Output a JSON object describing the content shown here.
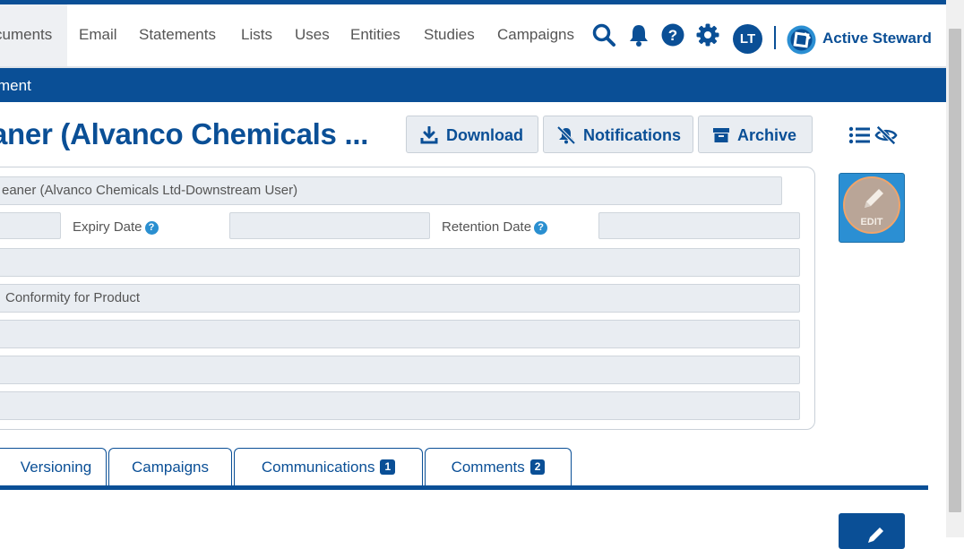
{
  "nav": {
    "items": [
      {
        "label": "cuments",
        "active": true
      },
      {
        "label": "Email"
      },
      {
        "label": "Statements"
      },
      {
        "label": "Lists"
      },
      {
        "label": "Uses"
      },
      {
        "label": "Entities"
      },
      {
        "label": "Studies"
      },
      {
        "label": "Campaigns"
      }
    ],
    "icons": [
      "search-icon",
      "bell-icon",
      "help-icon",
      "gear-icon"
    ],
    "avatar_initials": "LT",
    "brand": "Active Steward"
  },
  "subbar": {
    "text": "ment"
  },
  "document": {
    "title": "aner (Alvanco Chemicals ...",
    "actions": {
      "download": "Download",
      "notifications": "Notifications",
      "archive": "Archive"
    }
  },
  "form": {
    "name_value": "eaner (Alvanco Chemicals Ltd-Downstream User)",
    "expiry_label": "Expiry Date",
    "retention_label": "Retention Date",
    "help_glyph": "?",
    "type_value": "Conformity for Product"
  },
  "edit_tile": {
    "label": "EDIT"
  },
  "tabs": [
    {
      "label": "Versioning"
    },
    {
      "label": "Campaigns"
    },
    {
      "label": "Communications",
      "badge": "1"
    },
    {
      "label": "Comments",
      "badge": "2"
    }
  ],
  "colors": {
    "primary": "#0a4f96",
    "accent": "#2b8fd3",
    "field_bg": "#e9edf2"
  }
}
